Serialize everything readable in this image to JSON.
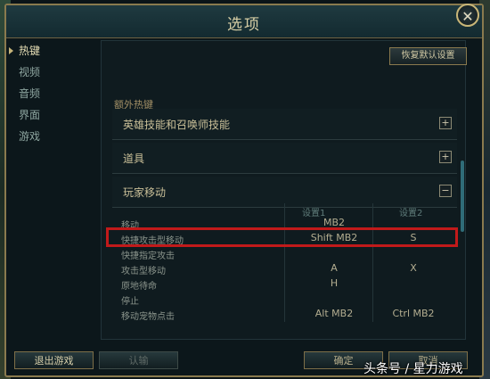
{
  "window": {
    "title": "选项",
    "close_label": "✕"
  },
  "sidebar": {
    "items": [
      {
        "label": "热键",
        "active": true
      },
      {
        "label": "视频",
        "active": false
      },
      {
        "label": "音频",
        "active": false
      },
      {
        "label": "界面",
        "active": false
      },
      {
        "label": "游戏",
        "active": false
      }
    ]
  },
  "toolbar": {
    "reset_label": "恢复默认设置"
  },
  "hotkeys": {
    "extra_label": "额外热键",
    "sections": [
      {
        "name": "英雄技能和召唤师技能",
        "toggle": "+"
      },
      {
        "name": "道具",
        "toggle": "+"
      },
      {
        "name": "玩家移动",
        "toggle": "−"
      }
    ],
    "columns": [
      "设置1",
      "设置2"
    ],
    "rows": [
      {
        "label": "移动",
        "key1": "MB2",
        "key2": ""
      },
      {
        "label": "快捷攻击型移动",
        "key1": "Shift MB2",
        "key2": "S"
      },
      {
        "label": "快捷指定攻击",
        "key1": "",
        "key2": ""
      },
      {
        "label": "攻击型移动",
        "key1": "A",
        "key2": "X"
      },
      {
        "label": "原地待命",
        "key1": "H",
        "key2": ""
      },
      {
        "label": "停止",
        "key1": "",
        "key2": ""
      },
      {
        "label": "移动宠物点击",
        "key1": "Alt MB2",
        "key2": "Ctrl MB2"
      }
    ]
  },
  "footer": {
    "exit_label": "退出游戏",
    "confirm_label": "认输",
    "ok_label": "确定",
    "cancel_label": "取消"
  },
  "watermark": "头条号 / 星力游戏",
  "colors": {
    "accent": "#c11a1a",
    "frame": "#8a7a4e"
  }
}
